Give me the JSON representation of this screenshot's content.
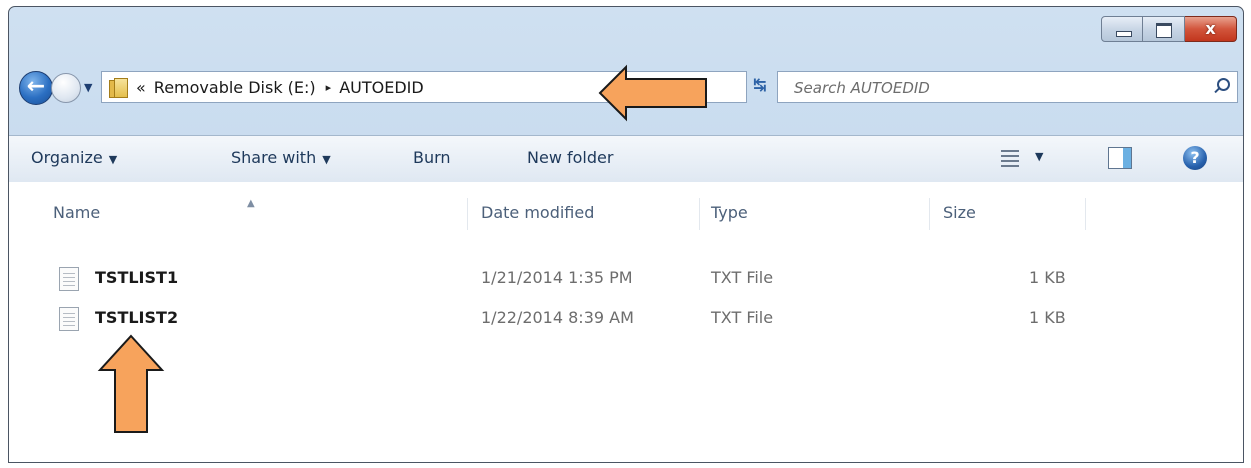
{
  "window": {
    "controls": [
      "minimize",
      "maximize",
      "close"
    ],
    "close_glyph": "x"
  },
  "navigation": {
    "back_icon": "back-arrow-icon",
    "forward_icon": "forward-arrow-icon",
    "breadcrumb_overflow": "«",
    "breadcrumb_sep": "▸",
    "breadcrumb": [
      "Removable Disk (E:)",
      "AUTOEDID"
    ],
    "search_placeholder": "Search AUTOEDID"
  },
  "toolbar": {
    "organize": "Organize",
    "share_with": "Share with",
    "burn": "Burn",
    "new_folder": "New folder"
  },
  "columns": [
    "Name",
    "Date modified",
    "Type",
    "Size"
  ],
  "files": [
    {
      "name": "TSTLIST1",
      "date": "1/21/2014 1:35 PM",
      "type": "TXT File",
      "size": "1 KB"
    },
    {
      "name": "TSTLIST2",
      "date": "1/22/2014 8:39 AM",
      "type": "TXT File",
      "size": "1 KB"
    }
  ],
  "colors": {
    "frame": "#bcd3ea",
    "annotation_arrow": "#f7a35c",
    "toolbar_text": "#1e395b"
  }
}
